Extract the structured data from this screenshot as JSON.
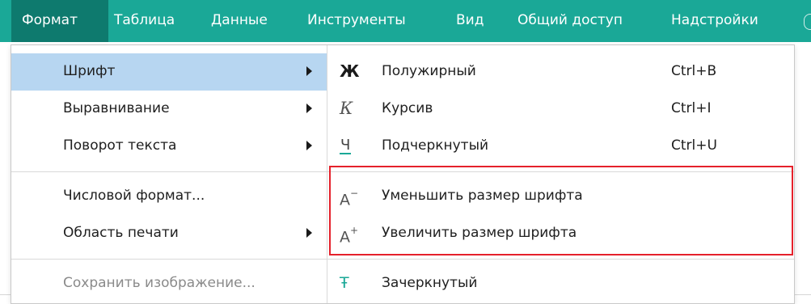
{
  "menubar": {
    "items": [
      {
        "label": "Формат"
      },
      {
        "label": "Таблица"
      },
      {
        "label": "Данные"
      },
      {
        "label": "Инструменты"
      },
      {
        "label": "Вид"
      },
      {
        "label": "Общий доступ"
      },
      {
        "label": "Надстройки"
      }
    ]
  },
  "format_menu": {
    "items": [
      {
        "label": "Шрифт",
        "has_submenu": true,
        "highlighted": true
      },
      {
        "label": "Выравнивание",
        "has_submenu": true
      },
      {
        "label": "Поворот текста",
        "has_submenu": true
      },
      {
        "label": "Числовой формат...",
        "has_submenu": false
      },
      {
        "label": "Область печати",
        "has_submenu": true
      },
      {
        "label": "Сохранить изображение...",
        "has_submenu": false,
        "disabled": true
      }
    ]
  },
  "font_submenu": {
    "items": [
      {
        "icon": "bold-icon",
        "glyph": "Ж",
        "label": "Полужирный",
        "shortcut": "Ctrl+B"
      },
      {
        "icon": "italic-icon",
        "glyph": "К",
        "label": "Курсив",
        "shortcut": "Ctrl+I"
      },
      {
        "icon": "underline-icon",
        "glyph": "Ч",
        "label": "Подчеркнутый",
        "shortcut": "Ctrl+U"
      },
      {
        "icon": "decrease-font-size-icon",
        "glyph": "A",
        "glyph_mod": "−",
        "label": "Уменьшить размер шрифта"
      },
      {
        "icon": "increase-font-size-icon",
        "glyph": "A",
        "glyph_mod": "+",
        "label": "Увеличить размер шрифта"
      },
      {
        "icon": "strikethrough-icon",
        "glyph": "Ŧ",
        "label": "Зачеркнутый"
      }
    ]
  },
  "colors": {
    "menubar_bg": "#1aa897",
    "active_menu_bg": "#0e7a6e",
    "row_highlight": "#b7d6f1",
    "annotation_box": "#e5212b"
  }
}
